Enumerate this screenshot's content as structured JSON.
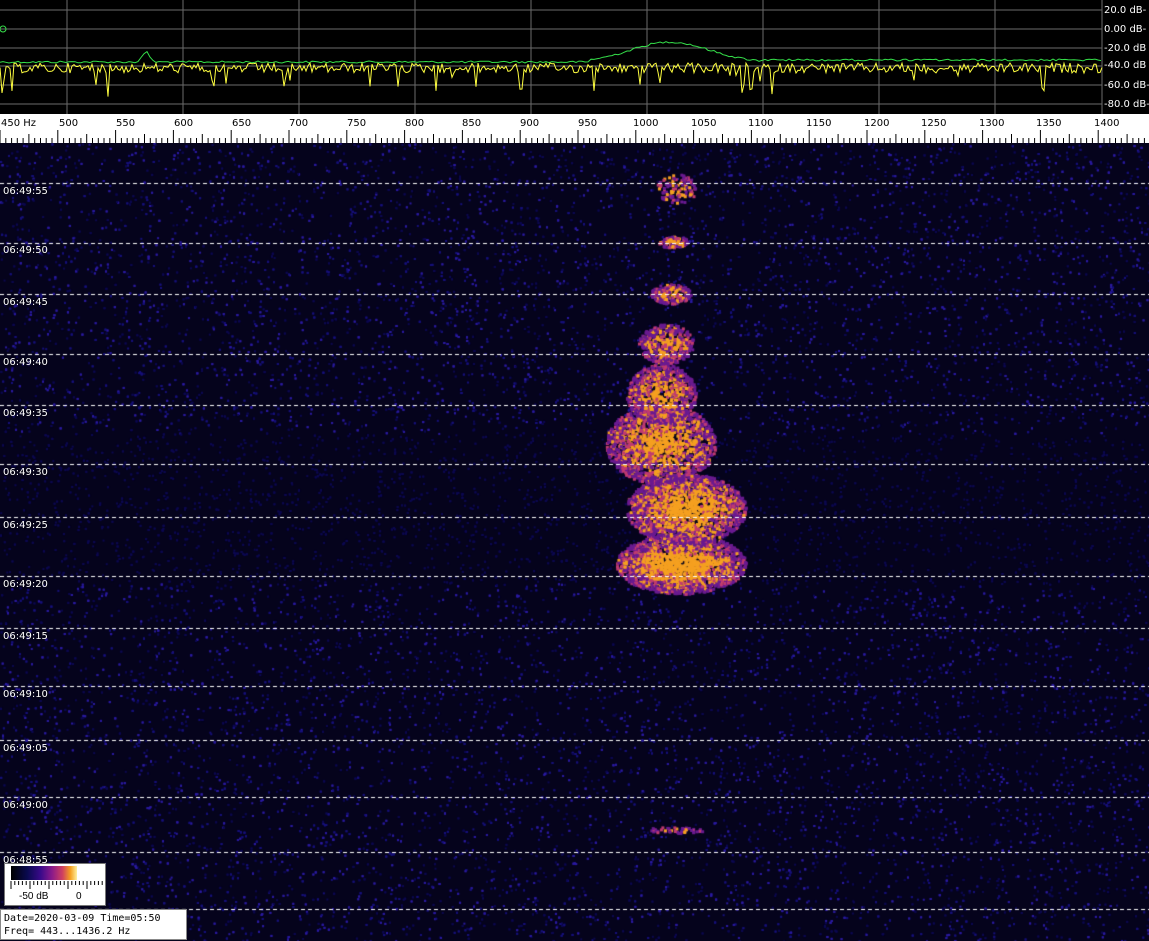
{
  "spectrum": {
    "db_labels": [
      "20.0 dB-",
      "0.00 dB-",
      "-20.0 dB",
      "-40.0 dB",
      "-60.0 dB-",
      "-80.0 dB-"
    ],
    "colors": {
      "grid": "#6b6b6b",
      "average_trace": "#35e04a",
      "live_trace": "#ffff40",
      "background": "#000000"
    }
  },
  "frequency_axis": {
    "unit": "Hz",
    "labels": [
      "450 Hz",
      "500",
      "550",
      "600",
      "650",
      "700",
      "750",
      "800",
      "850",
      "900",
      "950",
      "1000",
      "1050",
      "1100",
      "1150",
      "1200",
      "1250",
      "1300",
      "1350",
      "1400"
    ]
  },
  "waterfall": {
    "time_labels": [
      "06:49:55",
      "06:49:50",
      "06:49:45",
      "06:49:40",
      "06:49:35",
      "06:49:30",
      "06:49:25",
      "06:49:20",
      "06:49:15",
      "06:49:10",
      "06:49:05",
      "06:49:00",
      "06:48:55"
    ],
    "colors": {
      "noise": "#1a0f6e",
      "echo_hot": "#f5a020",
      "echo_warm": "#9a1a8a",
      "divider": "#ffffff"
    }
  },
  "colorbar": {
    "low_label": "-50 dB",
    "high_label": "0"
  },
  "info": {
    "line1": "Date=2020-03-09 Time=05:50",
    "line2": "Freq= 443...1436.2 Hz"
  }
}
